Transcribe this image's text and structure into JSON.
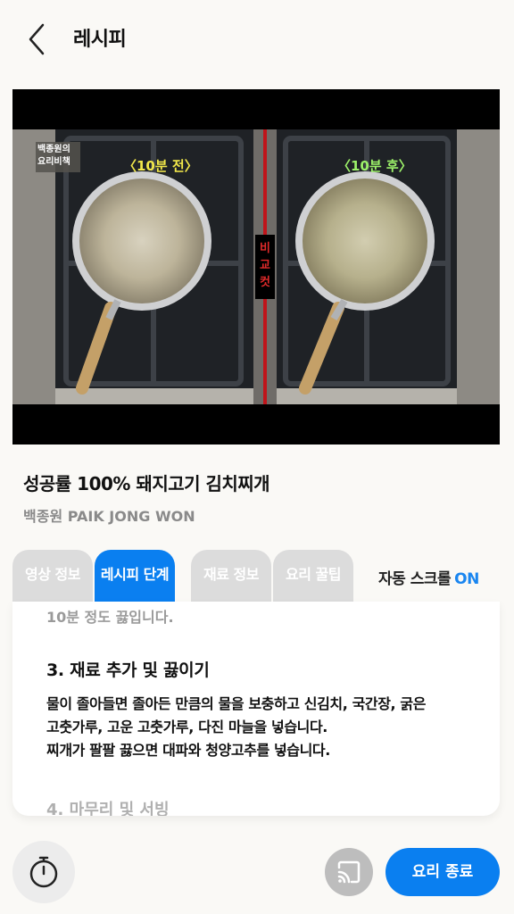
{
  "header": {
    "title": "레시피"
  },
  "video": {
    "logo": "백종원의 요리비책",
    "left_caption": "〈10분 전〉",
    "right_caption": "〈10분 후〉",
    "compare_label": "비교컷"
  },
  "recipe": {
    "title": "성공률 100% 돼지고기 김치찌개",
    "author": "백종원 PAIK JONG WON"
  },
  "tabs": [
    {
      "label": "영상 정보",
      "active": false
    },
    {
      "label": "레시피 단계",
      "active": true
    },
    {
      "label": "재료 정보",
      "active": false
    },
    {
      "label": "요리 꿀팁",
      "active": false
    }
  ],
  "auto_scroll": {
    "label": "자동 스크롤",
    "state": "ON"
  },
  "steps": {
    "prev_text": "10분 정도 끓입니다.",
    "current": {
      "heading": "3. 재료 추가 및 끓이기",
      "lines": [
        "물이 졸아들면 졸아든 만큼의 물을 보충하고 신김치, 국간장, 굵은",
        "고춧가루, 고운 고춧가루, 다진 마늘을 넣습니다.",
        "찌개가 팔팔 끓으면 대파와 청양고추를 넣습니다."
      ]
    },
    "next_heading": "4. 마무리 및 서빙"
  },
  "bottom": {
    "end_label": "요리 종료"
  },
  "colors": {
    "accent": "#0a7ff0",
    "tab_inactive": "#dcdcdc",
    "background": "#faf9f6"
  }
}
